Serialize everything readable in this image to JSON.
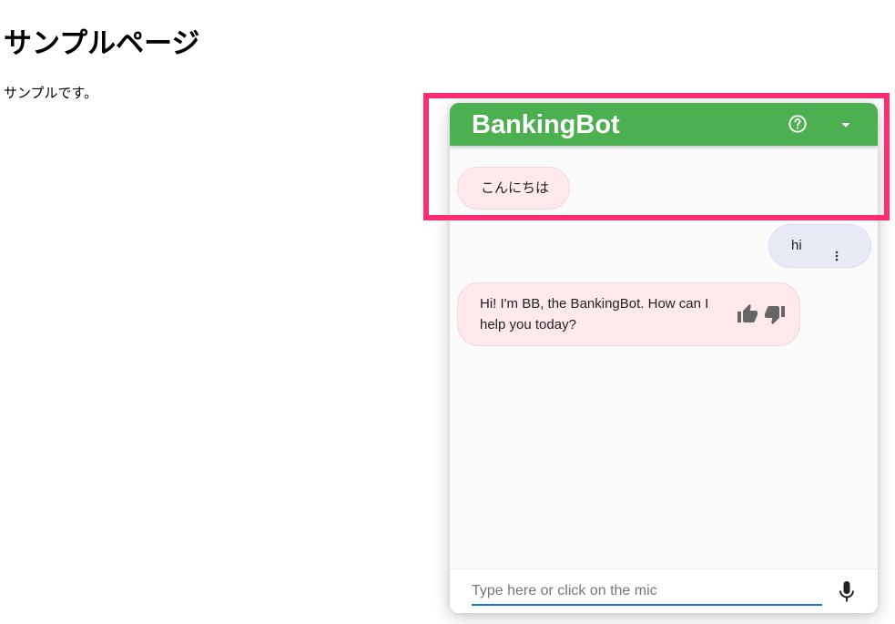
{
  "page": {
    "title": "サンプルページ",
    "body_text": "サンプルです。"
  },
  "chat": {
    "title": "BankingBot",
    "header_color": "#4caf50",
    "icons": {
      "help": "help-circle-icon",
      "collapse": "caret-down-icon",
      "more": "more-vertical-icon",
      "thumb_up": "thumb-up-icon",
      "thumb_down": "thumb-down-icon",
      "mic": "microphone-icon"
    },
    "messages": [
      {
        "from": "bot",
        "text": "こんにちは"
      },
      {
        "from": "user",
        "text": "hi"
      },
      {
        "from": "bot",
        "text": "Hi! I'm BB, the BankingBot. How can I help you today?"
      }
    ],
    "input": {
      "placeholder": "Type here or click on the mic",
      "value": ""
    }
  },
  "annotation": {
    "highlight_color": "#ff2d6f"
  }
}
